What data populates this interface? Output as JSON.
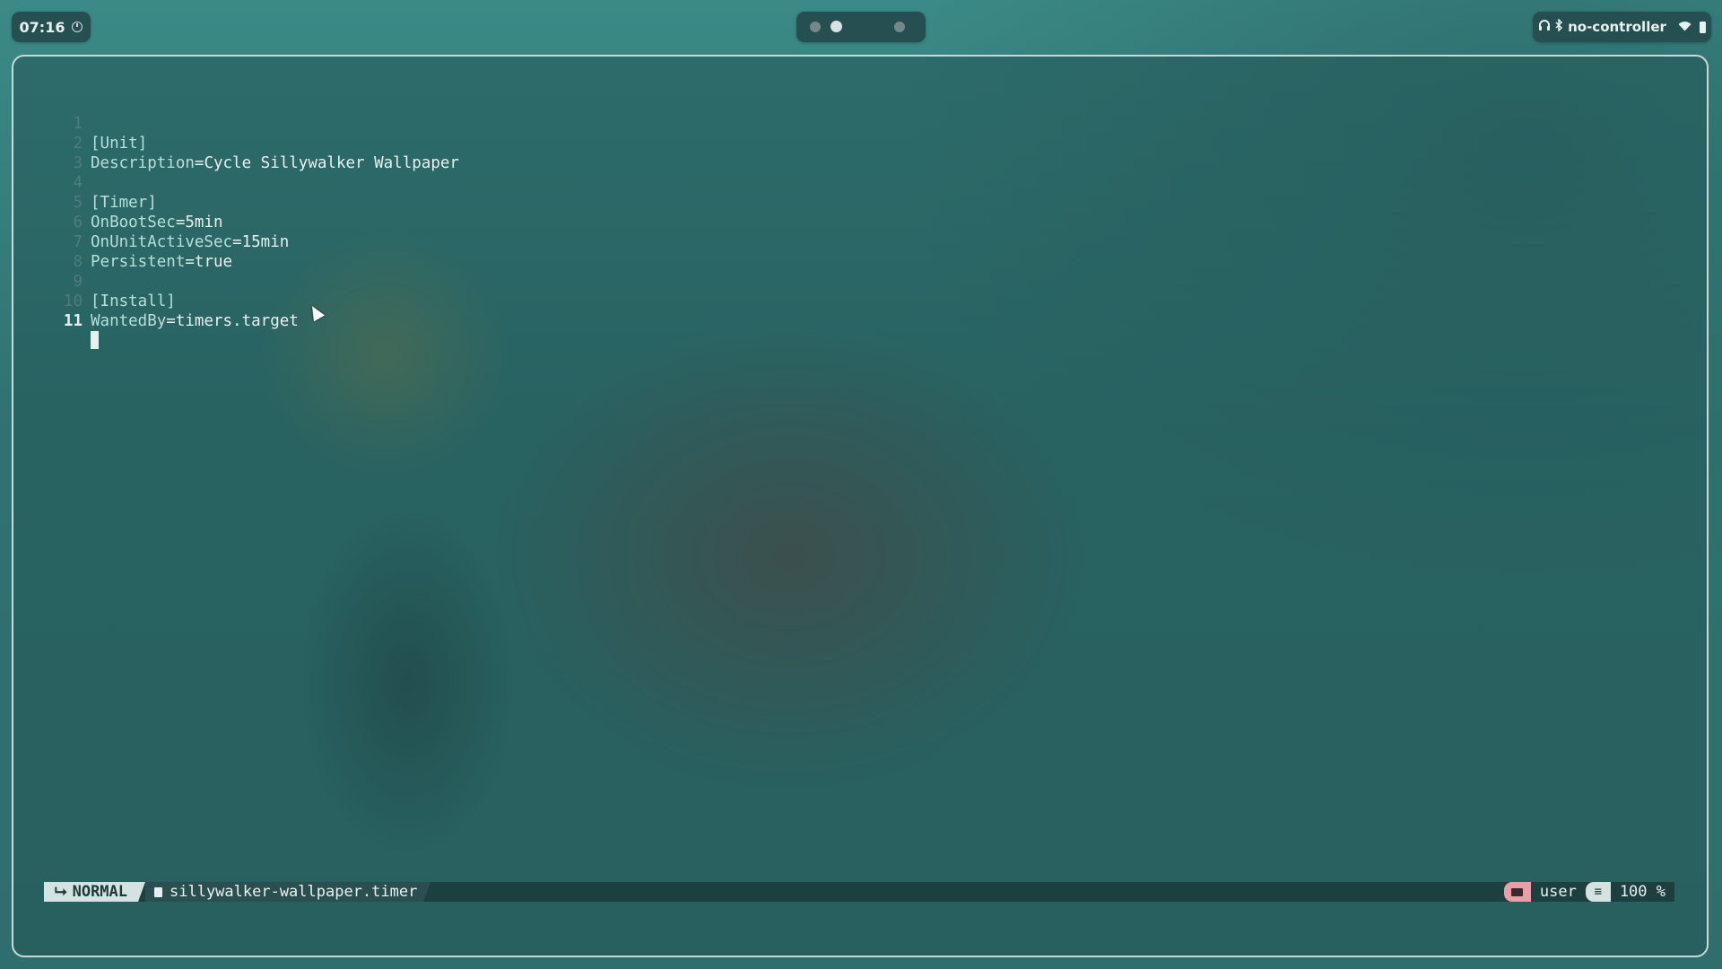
{
  "topbar": {
    "clock": "07:16",
    "status_text": "no-controller",
    "icons": [
      "clock-icon",
      "headphones-icon",
      "bluetooth-icon",
      "wifi-icon",
      "battery-icon"
    ],
    "workspaces": [
      {
        "state": "occupied"
      },
      {
        "state": "active"
      },
      {
        "state": "empty"
      },
      {
        "state": "occupied"
      }
    ]
  },
  "editor": {
    "lines": [
      {
        "num": "1",
        "section": "[Unit]"
      },
      {
        "num": "2",
        "key": "Description",
        "value": "Cycle Sillywalker Wallpaper"
      },
      {
        "num": "3"
      },
      {
        "num": "4",
        "section": "[Timer]"
      },
      {
        "num": "5",
        "key": "OnBootSec",
        "value": "5min"
      },
      {
        "num": "6",
        "key": "OnUnitActiveSec",
        "value": "15min"
      },
      {
        "num": "7",
        "key": "Persistent",
        "value": "true"
      },
      {
        "num": "8"
      },
      {
        "num": "9",
        "section": "[Install]"
      },
      {
        "num": "10",
        "key": "WantedBy",
        "value": "timers.target"
      },
      {
        "num": "11",
        "current": true
      }
    ]
  },
  "statusline": {
    "mode": "NORMAL",
    "filename": "sillywalker-wallpaper.timer",
    "user": "user",
    "progress": "100 %"
  },
  "colors": {
    "accent": "#d4e3e1",
    "folder_chip": "#e8a0a6",
    "bar_bg": "#254f50"
  }
}
